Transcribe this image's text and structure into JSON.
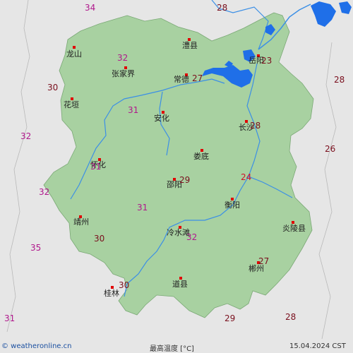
{
  "colors": {
    "background": "#e6e6e6",
    "province_fill": "#a8d1a1",
    "river": "#3b8fe6",
    "lake": "#1f6fe8",
    "city_dot": "#e00000",
    "temp_dark": "#7a0f1d",
    "temp_magenta": "#b0188c",
    "temp_red": "#d0102a"
  },
  "cities": [
    {
      "name": "澧县"
    },
    {
      "name": "龙山"
    },
    {
      "name": "张家界"
    },
    {
      "name": "岳阳"
    },
    {
      "name": "常德"
    },
    {
      "name": "花垣"
    },
    {
      "name": "安化"
    },
    {
      "name": "长沙"
    },
    {
      "name": "娄底"
    },
    {
      "name": "怀化"
    },
    {
      "name": "邵阳"
    },
    {
      "name": "衡阳"
    },
    {
      "name": "靖州"
    },
    {
      "name": "炎陵县"
    },
    {
      "name": "冷水滩"
    },
    {
      "name": "郴州"
    },
    {
      "name": "道县"
    },
    {
      "name": "桂林"
    }
  ],
  "temperatures": [
    {
      "value": "34",
      "tone": "magenta"
    },
    {
      "value": "28",
      "tone": "dark"
    },
    {
      "value": "32",
      "tone": "magenta"
    },
    {
      "value": "27",
      "tone": "dark"
    },
    {
      "value": "23",
      "tone": "dark"
    },
    {
      "value": "28",
      "tone": "dark"
    },
    {
      "value": "30",
      "tone": "dark"
    },
    {
      "value": "31",
      "tone": "magenta"
    },
    {
      "value": "28",
      "tone": "dark"
    },
    {
      "value": "32",
      "tone": "magenta"
    },
    {
      "value": "26",
      "tone": "dark"
    },
    {
      "value": "31",
      "tone": "magenta"
    },
    {
      "value": "29",
      "tone": "dark"
    },
    {
      "value": "24",
      "tone": "red"
    },
    {
      "value": "32",
      "tone": "magenta"
    },
    {
      "value": "31",
      "tone": "magenta"
    },
    {
      "value": "30",
      "tone": "dark"
    },
    {
      "value": "35",
      "tone": "magenta"
    },
    {
      "value": "32",
      "tone": "magenta"
    },
    {
      "value": "27",
      "tone": "dark"
    },
    {
      "value": "30",
      "tone": "dark"
    },
    {
      "value": "31",
      "tone": "magenta"
    },
    {
      "value": "29",
      "tone": "dark"
    },
    {
      "value": "28",
      "tone": "dark"
    }
  ],
  "footer": {
    "copyright": "© weatheronline.cn",
    "title": "最高温度 [°C]",
    "date": "15.04.2024 CST"
  }
}
